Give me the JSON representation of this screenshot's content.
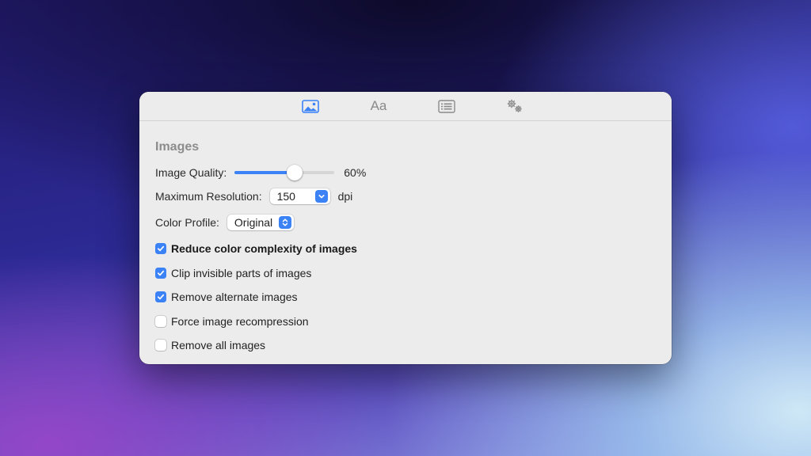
{
  "toolbar": {
    "tabs": [
      {
        "icon": "image-icon",
        "selected": true
      },
      {
        "icon": "text-aa-icon",
        "label": "Aa",
        "selected": false
      },
      {
        "icon": "list-icon",
        "selected": false
      },
      {
        "icon": "gears-icon",
        "selected": false
      }
    ]
  },
  "section": {
    "title": "Images"
  },
  "image_quality": {
    "label": "Image Quality:",
    "value": 0.6,
    "value_text": "60%"
  },
  "max_resolution": {
    "label": "Maximum Resolution:",
    "value": "150",
    "unit": "dpi"
  },
  "color_profile": {
    "label": "Color Profile:",
    "value": "Original"
  },
  "options": [
    {
      "label": "Reduce color complexity of images",
      "checked": true
    },
    {
      "label": "Clip invisible parts of images",
      "checked": true
    },
    {
      "label": "Remove alternate images",
      "checked": true
    },
    {
      "label": "Force image recompression",
      "checked": false
    },
    {
      "label": "Remove all images",
      "checked": false
    }
  ],
  "colors": {
    "accent": "#3b82f6",
    "window_bg": "#ececec"
  }
}
